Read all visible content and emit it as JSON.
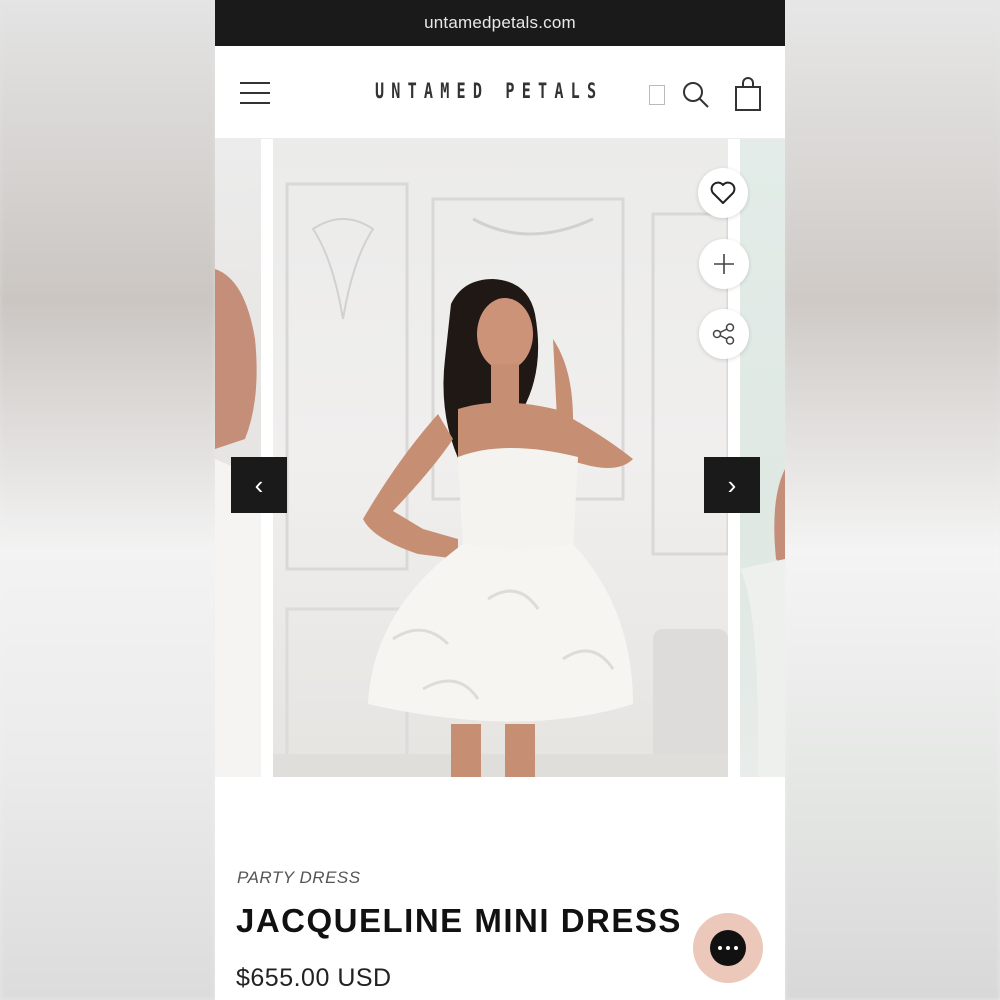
{
  "browser": {
    "url": "untamedpetals.com"
  },
  "header": {
    "brand": "UNTAMED PETALS",
    "menu_icon": "hamburger-menu-icon",
    "search_icon": "search-icon",
    "cart_icon": "shopping-bag-icon"
  },
  "gallery": {
    "wishlist_icon": "heart-icon",
    "add_icon": "plus-icon",
    "share_icon": "share-icon",
    "prev_label": "‹",
    "next_label": "›"
  },
  "product": {
    "type": "PARTY DRESS",
    "title": "JACQUELINE MINI DRESS",
    "price": "$655.00 USD"
  },
  "chat": {
    "icon": "chat-bubble-icon"
  },
  "colors": {
    "url_bar_bg": "#1b1a1a",
    "arrow_bg": "#1a1a1a",
    "chat_bg": "#ebc8ba"
  }
}
